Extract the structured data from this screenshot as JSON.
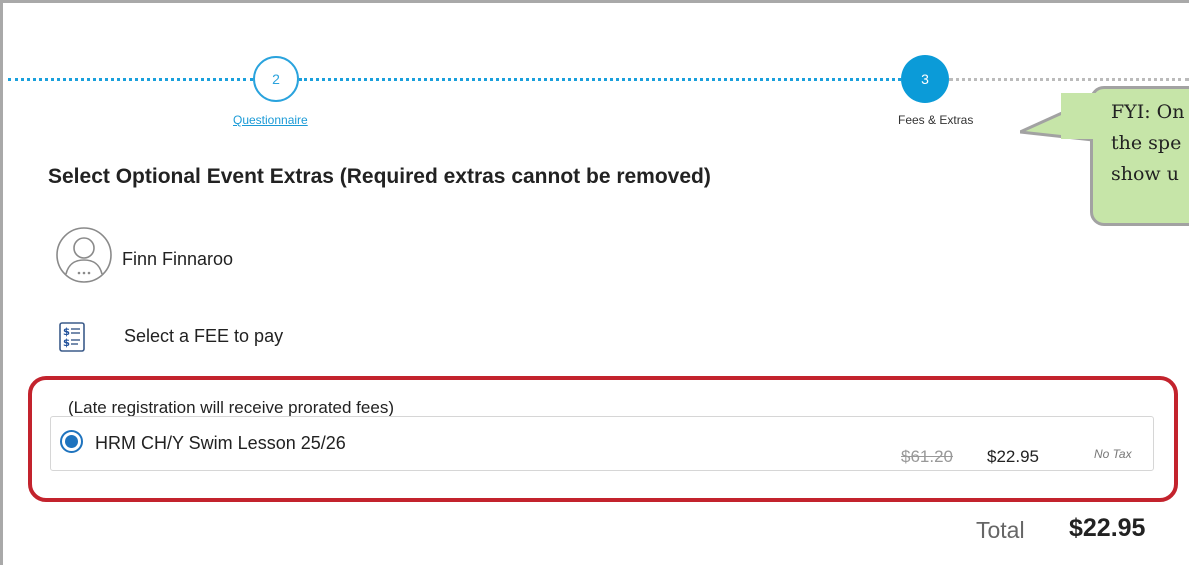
{
  "stepper": {
    "steps": [
      {
        "number": "2",
        "label": "Questionnaire",
        "state": "completed-link"
      },
      {
        "number": "3",
        "label": "Fees & Extras",
        "state": "active"
      }
    ],
    "colors": {
      "active": "#0b9bd8",
      "line": "#1aa0dc",
      "pending": "#bbbbbb"
    }
  },
  "callout": {
    "lines": [
      "FYI: On",
      "the spe",
      "show u"
    ],
    "color": "#c6e5a8"
  },
  "section": {
    "title": "Select Optional Event Extras (Required extras cannot be removed)"
  },
  "member": {
    "name": "Finn Finnaroo",
    "avatar_icon": "user-avatar-icon"
  },
  "fees": {
    "icon": "fee-list-icon",
    "prompt": "Select a FEE to pay",
    "note": "(Late registration will receive prorated fees)",
    "options": [
      {
        "name": "HRM CH/Y Swim Lesson 25/26",
        "original_price": "$61.20",
        "price": "$22.95",
        "tax": "No Tax",
        "selected": true
      }
    ],
    "highlight_color": "#c3232d"
  },
  "total": {
    "label": "Total",
    "value": "$22.95"
  }
}
